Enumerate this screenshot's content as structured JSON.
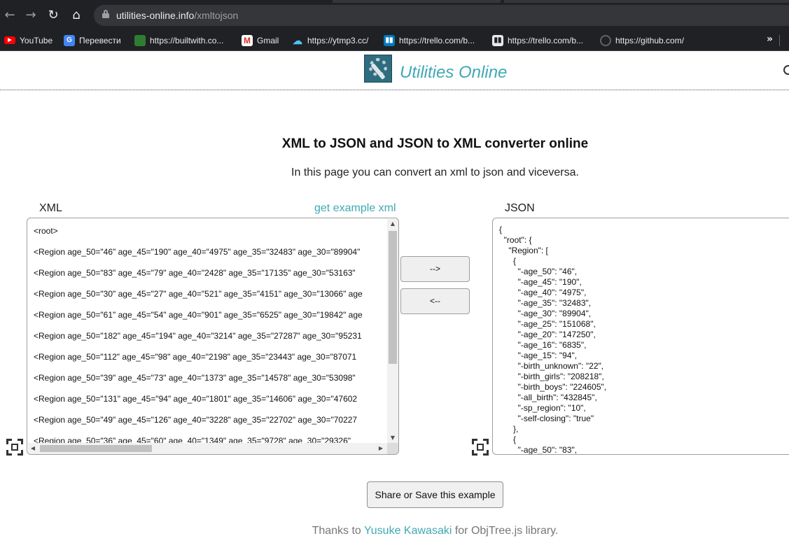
{
  "browser": {
    "url_host": "utilities-online.info",
    "url_path": "/xmltojson",
    "bookmarks": [
      {
        "label": "YouTube",
        "icon": "youtube-icon"
      },
      {
        "label": "Перевести",
        "icon": "google-translate-icon"
      },
      {
        "label": "https://builtwith.co...",
        "icon": "builtwith-icon"
      },
      {
        "label": "Gmail",
        "icon": "gmail-icon"
      },
      {
        "label": "https://ytmp3.cc/",
        "icon": "ytmp3-icon"
      },
      {
        "label": "https://trello.com/b...",
        "icon": "trello-icon"
      },
      {
        "label": "https://trello.com/b...",
        "icon": "trello-icon"
      },
      {
        "label": "https://github.com/",
        "icon": "github-icon"
      }
    ],
    "bookmarks_more": "»"
  },
  "site": {
    "title": "Utilities Online"
  },
  "main": {
    "heading": "XML to JSON and JSON to XML converter online",
    "subtitle": "In this page you can convert an xml to json and viceversa.",
    "xml_label": "XML",
    "example_link": "get example xml",
    "json_label": "JSON",
    "to_json_button": "-->",
    "to_xml_button": "<--",
    "share_button": "Share or Save this example"
  },
  "xml_editor": {
    "lines": [
      "<root>",
      "<Region age_50=\"46\" age_45=\"190\" age_40=\"4975\" age_35=\"32483\" age_30=\"89904\"",
      "<Region age_50=\"83\" age_45=\"79\" age_40=\"2428\" age_35=\"17135\" age_30=\"53163\"",
      "<Region age_50=\"30\" age_45=\"27\" age_40=\"521\" age_35=\"4151\" age_30=\"13066\" age",
      "<Region age_50=\"61\" age_45=\"54\" age_40=\"901\" age_35=\"6525\" age_30=\"19842\" age",
      "<Region age_50=\"182\" age_45=\"194\" age_40=\"3214\" age_35=\"27287\" age_30=\"95231",
      "<Region age_50=\"112\" age_45=\"98\" age_40=\"2198\" age_35=\"23443\" age_30=\"87071",
      "<Region age_50=\"39\" age_45=\"73\" age_40=\"1373\" age_35=\"14578\" age_30=\"53098\"",
      "<Region age_50=\"131\" age_45=\"94\" age_40=\"1801\" age_35=\"14606\" age_30=\"47602",
      "<Region age_50=\"49\" age_45=\"126\" age_40=\"3228\" age_35=\"22702\" age_30=\"70227",
      "<Region age_50=\"36\" age_45=\"60\" age_40=\"1349\" age_35=\"9728\" age_30=\"29326\""
    ]
  },
  "json_editor": {
    "lines": [
      "{",
      "  \"root\": {",
      "    \"Region\": [",
      "      {",
      "        \"-age_50\": \"46\",",
      "        \"-age_45\": \"190\",",
      "        \"-age_40\": \"4975\",",
      "        \"-age_35\": \"32483\",",
      "        \"-age_30\": \"89904\",",
      "        \"-age_25\": \"151068\",",
      "        \"-age_20\": \"147250\",",
      "        \"-age_16\": \"6835\",",
      "        \"-age_15\": \"94\",",
      "        \"-birth_unknown\": \"22\",",
      "        \"-birth_girls\": \"208218\",",
      "        \"-birth_boys\": \"224605\",",
      "        \"-all_birth\": \"432845\",",
      "        \"-sp_region\": \"10\",",
      "        \"-self-closing\": \"true\"",
      "      },",
      "      {",
      "        \"-age_50\": \"83\","
    ]
  },
  "footer": {
    "prefix": "Thanks to ",
    "author": "Yusuke Kawasaki",
    "suffix": " for ObjTree.js library."
  }
}
